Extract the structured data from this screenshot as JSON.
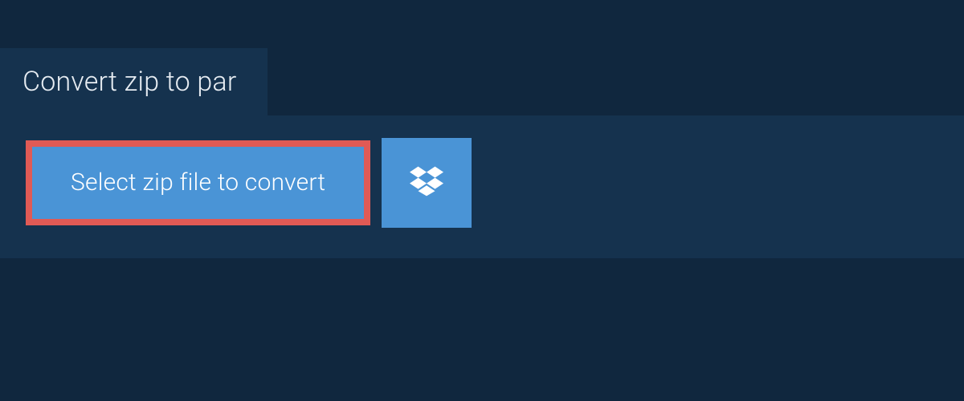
{
  "tab": {
    "label": "Convert zip to par"
  },
  "upload": {
    "select_button_label": "Select zip file to convert"
  },
  "colors": {
    "page_bg": "#10273e",
    "panel_bg": "#15324e",
    "button_bg": "#4a94d6",
    "button_border": "#e05a55",
    "text_light": "#e6ecf2",
    "text_white": "#ffffff"
  }
}
